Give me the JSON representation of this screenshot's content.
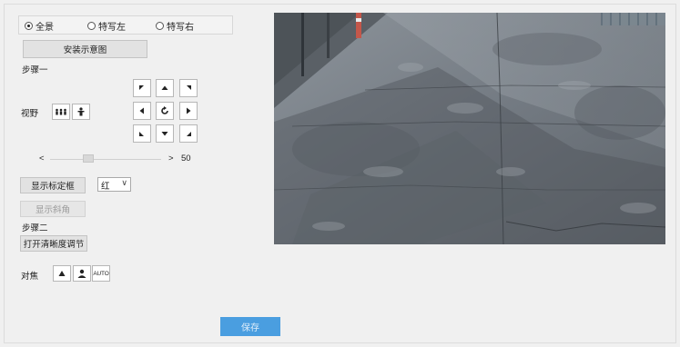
{
  "view_mode": {
    "options": [
      {
        "label": "全景",
        "selected": true
      },
      {
        "label": "特写左",
        "selected": false
      },
      {
        "label": "特写右",
        "selected": false
      }
    ]
  },
  "buttons": {
    "install_diagram": "安装示意图",
    "show_calibration_box": "显示标定框",
    "show_tilt_angle": "显示斜角",
    "open_clarity_adjust": "打开清晰度调节",
    "save": "保存"
  },
  "labels": {
    "step1": "步骤一",
    "view": "视野",
    "step2": "步骤二",
    "focus": "对焦"
  },
  "ptz": {
    "center_icon": "rotate-icon"
  },
  "speed": {
    "left_arrow": "<",
    "right_arrow": ">",
    "value": "50",
    "level_fraction": 0.33
  },
  "color_select": {
    "value": "红",
    "chevron": "∨"
  },
  "focus": {
    "auto_label": "AUTO"
  },
  "video": {
    "description_icon": "road-camera-feed"
  }
}
